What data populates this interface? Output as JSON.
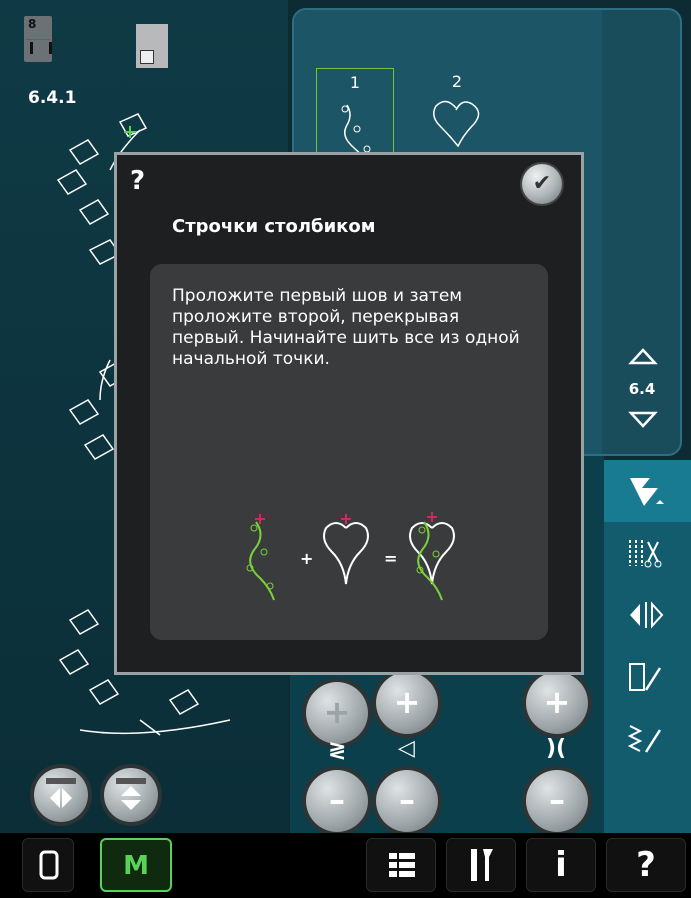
{
  "left": {
    "presser_foot": "8",
    "stitch_code": "6.4.1"
  },
  "menu": {
    "stitches": [
      {
        "number": "1",
        "selected": true
      },
      {
        "number": "2",
        "selected": false
      }
    ],
    "page": "6.4"
  },
  "dialog": {
    "help_mark": "?",
    "ok_mark": "✔",
    "title": "Строчки столбиком",
    "text": "Проложите первый шов и затем проложите второй, перекрывая первый. Начинайте шить все из одной начальной точки.",
    "equation_plus": "+",
    "equation_equals": "="
  },
  "controls": {
    "plus": "+",
    "minus": "–"
  },
  "bottom_bar": {
    "info_mark": "i",
    "help_mark": "?",
    "m_mark": "M"
  },
  "colors": {
    "accent_green": "#5bd05b",
    "panel_teal": "#1a4d5c",
    "dialog_bg": "#1e1f20",
    "cursor_red": "#d1285b"
  }
}
